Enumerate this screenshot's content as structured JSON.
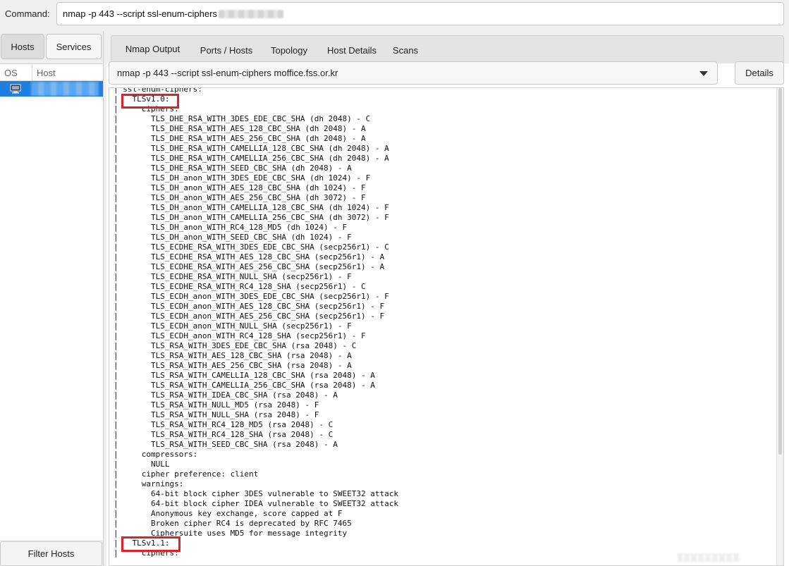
{
  "command": {
    "label": "Command:",
    "value": "nmap -p 443 --script ssl-enum-ciphers"
  },
  "left_tabs": [
    "Hosts",
    "Services"
  ],
  "hosts_list": {
    "col_os": "OS",
    "col_host": "Host"
  },
  "filter_hosts_label": "Filter Hosts",
  "tabs": [
    "Nmap Output",
    "Ports / Hosts",
    "Topology",
    "Host Details",
    "Scans"
  ],
  "history_select_value": "nmap -p 443 --script ssl-enum-ciphers moffice.fss.or.kr",
  "details_label": "Details",
  "output_text": "| ssl-enum-ciphers:\n|   TLSv1.0:\n|     ciphers:\n|       TLS_DHE_RSA_WITH_3DES_EDE_CBC_SHA (dh 2048) - C\n|       TLS_DHE_RSA_WITH_AES_128_CBC_SHA (dh 2048) - A\n|       TLS_DHE_RSA_WITH_AES_256_CBC_SHA (dh 2048) - A\n|       TLS_DHE_RSA_WITH_CAMELLIA_128_CBC_SHA (dh 2048) - A\n|       TLS_DHE_RSA_WITH_CAMELLIA_256_CBC_SHA (dh 2048) - A\n|       TLS_DHE_RSA_WITH_SEED_CBC_SHA (dh 2048) - A\n|       TLS_DH_anon_WITH_3DES_EDE_CBC_SHA (dh 1024) - F\n|       TLS_DH_anon_WITH_AES_128_CBC_SHA (dh 1024) - F\n|       TLS_DH_anon_WITH_AES_256_CBC_SHA (dh 3072) - F\n|       TLS_DH_anon_WITH_CAMELLIA_128_CBC_SHA (dh 1024) - F\n|       TLS_DH_anon_WITH_CAMELLIA_256_CBC_SHA (dh 3072) - F\n|       TLS_DH_anon_WITH_RC4_128_MD5 (dh 1024) - F\n|       TLS_DH_anon_WITH_SEED_CBC_SHA (dh 1024) - F\n|       TLS_ECDHE_RSA_WITH_3DES_EDE_CBC_SHA (secp256r1) - C\n|       TLS_ECDHE_RSA_WITH_AES_128_CBC_SHA (secp256r1) - A\n|       TLS_ECDHE_RSA_WITH_AES_256_CBC_SHA (secp256r1) - A\n|       TLS_ECDHE_RSA_WITH_NULL_SHA (secp256r1) - F\n|       TLS_ECDHE_RSA_WITH_RC4_128_SHA (secp256r1) - C\n|       TLS_ECDH_anon_WITH_3DES_EDE_CBC_SHA (secp256r1) - F\n|       TLS_ECDH_anon_WITH_AES_128_CBC_SHA (secp256r1) - F\n|       TLS_ECDH_anon_WITH_AES_256_CBC_SHA (secp256r1) - F\n|       TLS_ECDH_anon_WITH_NULL_SHA (secp256r1) - F\n|       TLS_ECDH_anon_WITH_RC4_128_SHA (secp256r1) - F\n|       TLS_RSA_WITH_3DES_EDE_CBC_SHA (rsa 2048) - C\n|       TLS_RSA_WITH_AES_128_CBC_SHA (rsa 2048) - A\n|       TLS_RSA_WITH_AES_256_CBC_SHA (rsa 2048) - A\n|       TLS_RSA_WITH_CAMELLIA_128_CBC_SHA (rsa 2048) - A\n|       TLS_RSA_WITH_CAMELLIA_256_CBC_SHA (rsa 2048) - A\n|       TLS_RSA_WITH_IDEA_CBC_SHA (rsa 2048) - A\n|       TLS_RSA_WITH_NULL_MD5 (rsa 2048) - F\n|       TLS_RSA_WITH_NULL_SHA (rsa 2048) - F\n|       TLS_RSA_WITH_RC4_128_MD5 (rsa 2048) - C\n|       TLS_RSA_WITH_RC4_128_SHA (rsa 2048) - C\n|       TLS_RSA_WITH_SEED_CBC_SHA (rsa 2048) - A\n|     compressors:\n|       NULL\n|     cipher preference: client\n|     warnings:\n|       64-bit block cipher 3DES vulnerable to SWEET32 attack\n|       64-bit block cipher IDEA vulnerable to SWEET32 attack\n|       Anonymous key exchange, score capped at F\n|       Broken cipher RC4 is deprecated by RFC 7465\n|       Ciphersuite uses MD5 for message integrity\n|   TLSv1.1:\n|     ciphers:",
  "colors": {
    "accent": "#2b7fd6",
    "selection": "#1e7fe0",
    "highlight_box": "#e0202a"
  }
}
